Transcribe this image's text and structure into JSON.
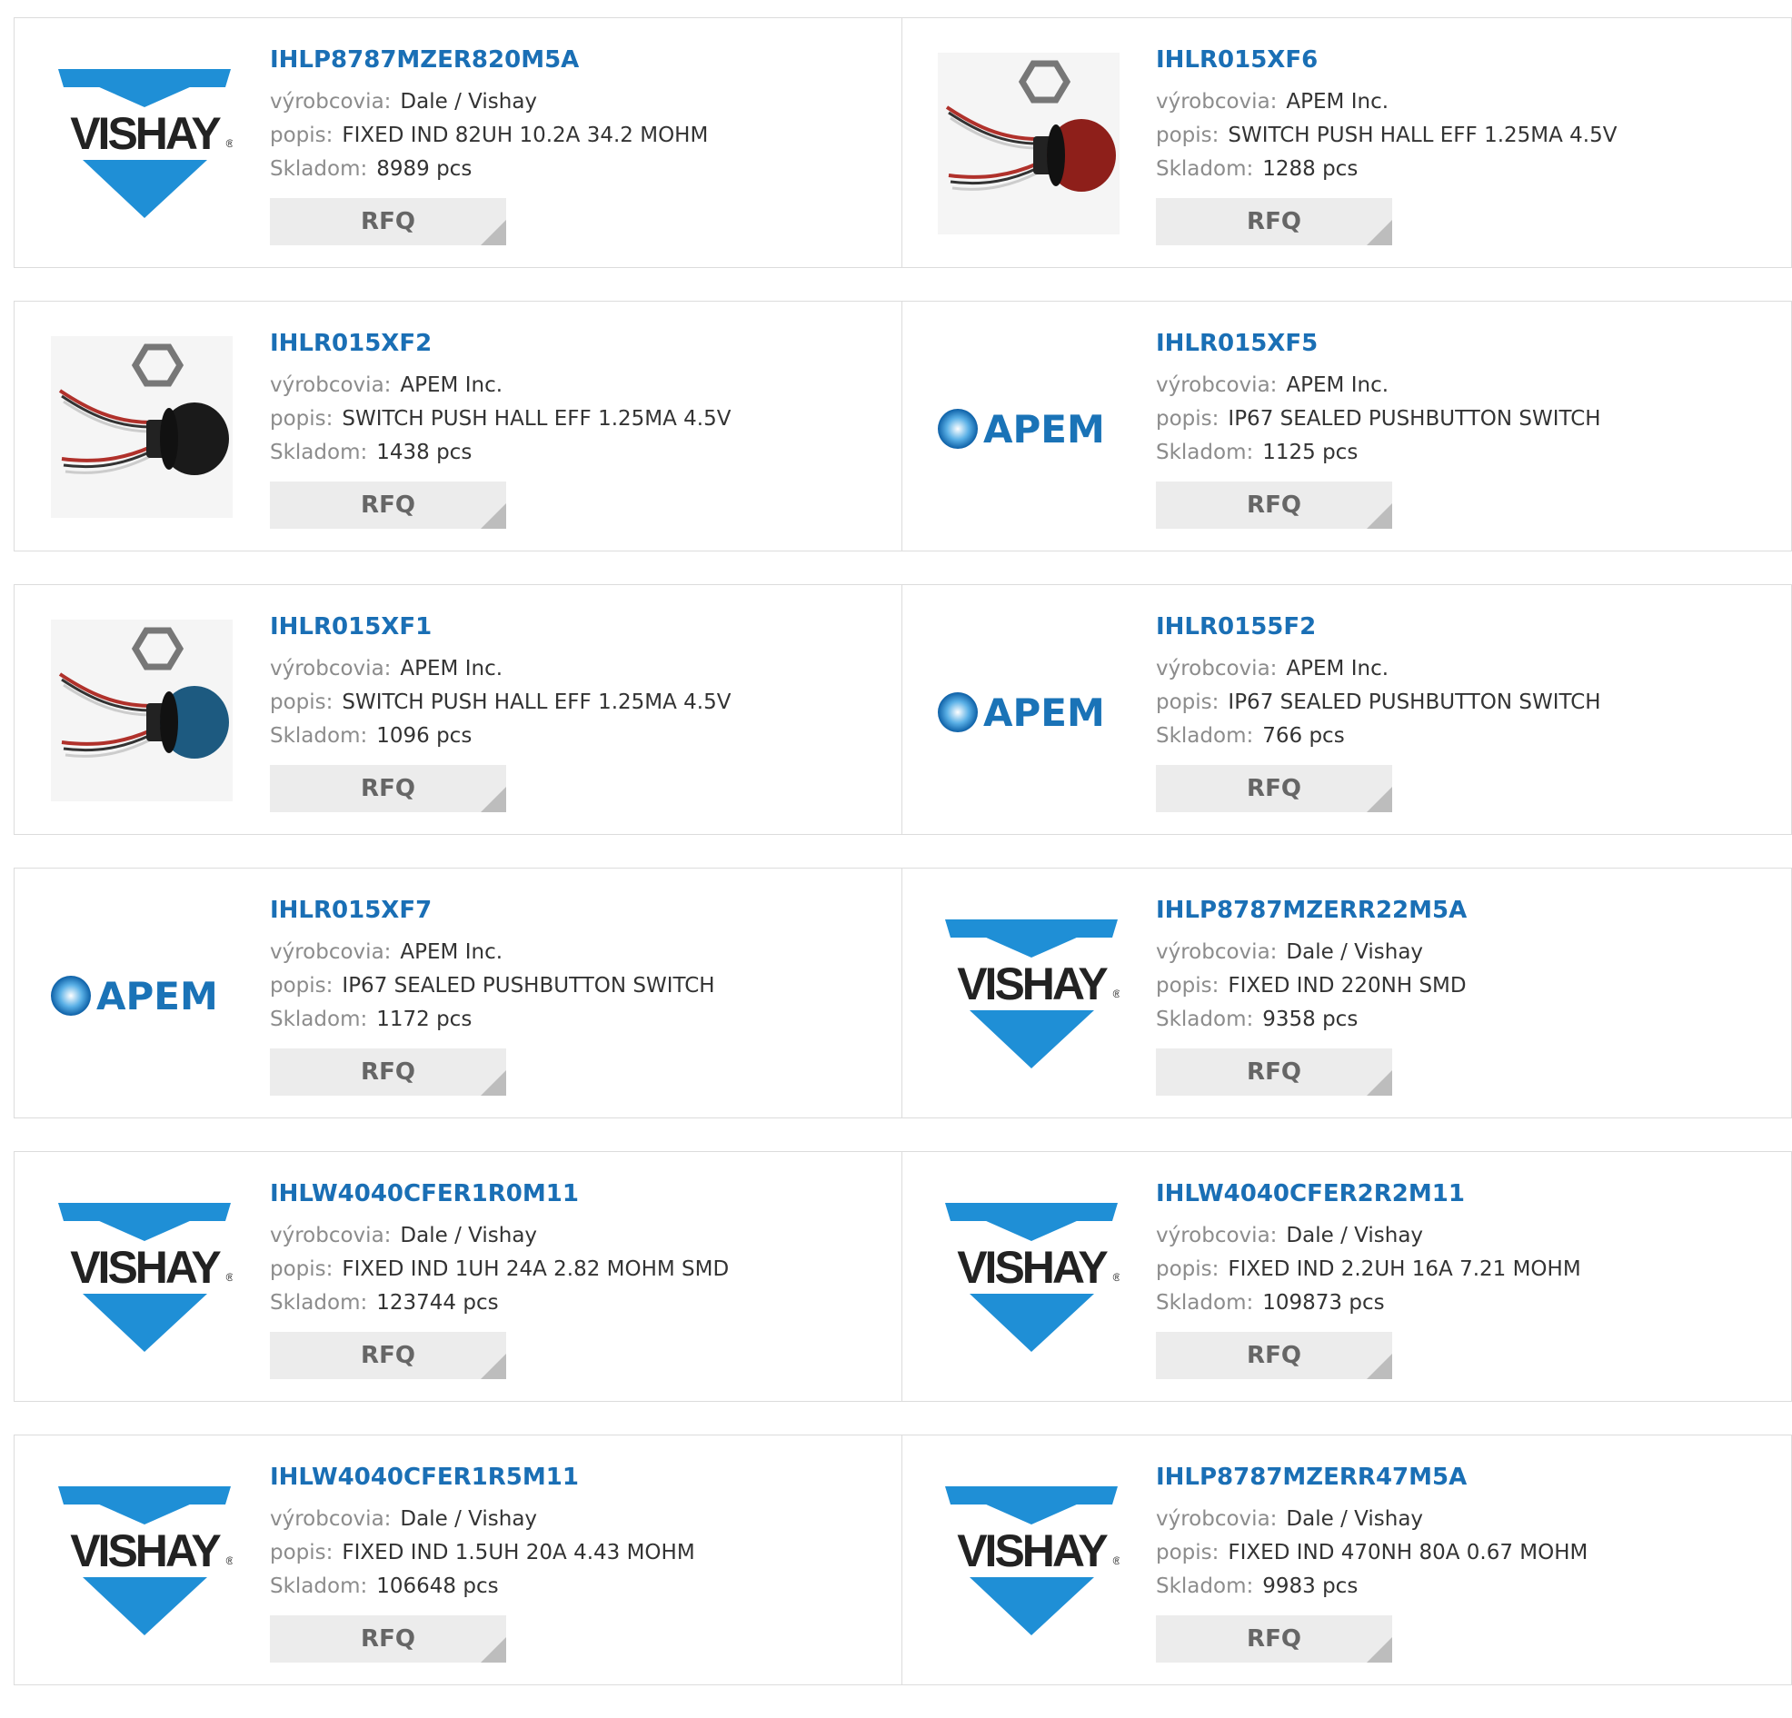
{
  "labels": {
    "manufacturer": "výrobcovia:",
    "description": "popis:",
    "stock": "Skladom:",
    "rfq": "RFQ"
  },
  "colors": {
    "part_link": "#1a6fb5",
    "vishay_blue": "#1f8fd6",
    "apem_blue": "#1a73b7"
  },
  "logos": {
    "vishay": "VISHAY",
    "vishay_mark": "®",
    "apem": "APEM"
  },
  "products": [
    {
      "part": "IHLP8787MZER820M5A",
      "manufacturer": "Dale / Vishay",
      "description": "FIXED IND 82UH 10.2A 34.2 MOHM",
      "stock": "8989 pcs",
      "image": "vishay-logo"
    },
    {
      "part": "IHLR015XF6",
      "manufacturer": "APEM Inc.",
      "description": "SWITCH PUSH HALL EFF 1.25MA 4.5V",
      "stock": "1288 pcs",
      "image": "red-pushbutton-switch-photo"
    },
    {
      "part": "IHLR015XF2",
      "manufacturer": "APEM Inc.",
      "description": "SWITCH PUSH HALL EFF 1.25MA 4.5V",
      "stock": "1438 pcs",
      "image": "black-pushbutton-switch-photo"
    },
    {
      "part": "IHLR015XF5",
      "manufacturer": "APEM Inc.",
      "description": "IP67 SEALED PUSHBUTTON SWITCH",
      "stock": "1125 pcs",
      "image": "apem-logo"
    },
    {
      "part": "IHLR015XF1",
      "manufacturer": "APEM Inc.",
      "description": "SWITCH PUSH HALL EFF 1.25MA 4.5V",
      "stock": "1096 pcs",
      "image": "blue-pushbutton-switch-photo"
    },
    {
      "part": "IHLR0155F2",
      "manufacturer": "APEM Inc.",
      "description": "IP67 SEALED PUSHBUTTON SWITCH",
      "stock": "766 pcs",
      "image": "apem-logo"
    },
    {
      "part": "IHLR015XF7",
      "manufacturer": "APEM Inc.",
      "description": "IP67 SEALED PUSHBUTTON SWITCH",
      "stock": "1172 pcs",
      "image": "apem-logo"
    },
    {
      "part": "IHLP8787MZERR22M5A",
      "manufacturer": "Dale / Vishay",
      "description": "FIXED IND 220NH SMD",
      "stock": "9358 pcs",
      "image": "vishay-logo"
    },
    {
      "part": "IHLW4040CFER1R0M11",
      "manufacturer": "Dale / Vishay",
      "description": "FIXED IND 1UH 24A 2.82 MOHM SMD",
      "stock": "123744 pcs",
      "image": "vishay-logo"
    },
    {
      "part": "IHLW4040CFER2R2M11",
      "manufacturer": "Dale / Vishay",
      "description": "FIXED IND 2.2UH 16A 7.21 MOHM",
      "stock": "109873 pcs",
      "image": "vishay-logo"
    },
    {
      "part": "IHLW4040CFER1R5M11",
      "manufacturer": "Dale / Vishay",
      "description": "FIXED IND 1.5UH 20A 4.43 MOHM",
      "stock": "106648 pcs",
      "image": "vishay-logo"
    },
    {
      "part": "IHLP8787MZERR47M5A",
      "manufacturer": "Dale / Vishay",
      "description": "FIXED IND 470NH 80A 0.67 MOHM",
      "stock": "9983 pcs",
      "image": "vishay-logo"
    }
  ]
}
